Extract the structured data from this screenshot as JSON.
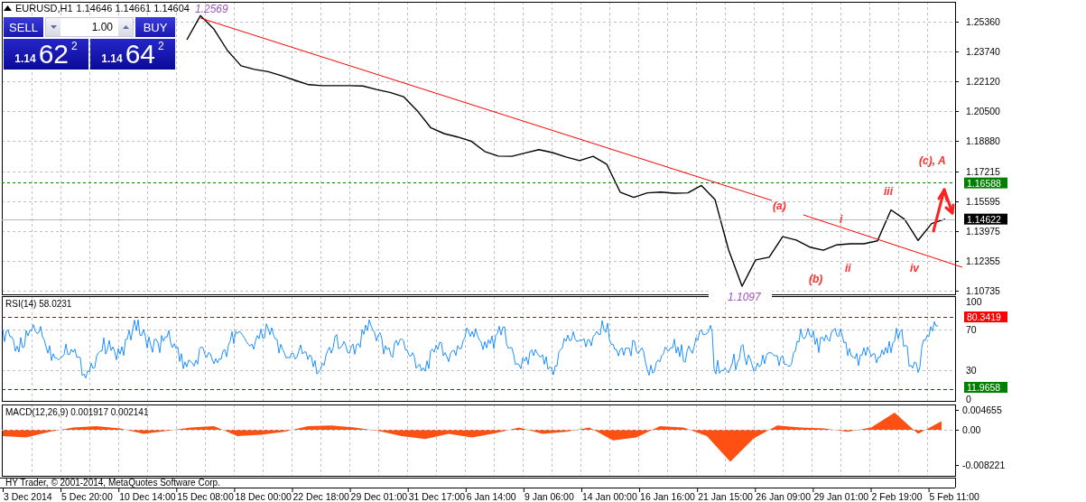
{
  "chart_header": {
    "symbol": "EURUSD,H1",
    "prices": "1.14646 1.14661 1.14604"
  },
  "trade_panel": {
    "sell_label": "SELL",
    "buy_label": "BUY",
    "volume": "1.00",
    "sell_price": {
      "prefix": "1.14",
      "big": "62",
      "sup": "2"
    },
    "buy_price": {
      "prefix": "1.14",
      "big": "64",
      "sup": "2"
    }
  },
  "main_chart": {
    "high_label": "1.2569",
    "low_label": "1.1097",
    "markers": [
      {
        "label": "1.16588",
        "color": "#008000"
      },
      {
        "label": "1.14622",
        "color": "#000000"
      }
    ],
    "wave_labels": [
      "(a)",
      "(b)",
      "(c), A",
      "i",
      "ii",
      "iii",
      "iv"
    ],
    "chart_data": {
      "type": "line",
      "ylim": [
        1.1053,
        1.2644
      ],
      "yticks": [
        {
          "value": 1.2536,
          "label": "1.25360"
        },
        {
          "value": 1.2374,
          "label": "1.23740"
        },
        {
          "value": 1.2212,
          "label": "1.22120"
        },
        {
          "value": 1.205,
          "label": "1.20500"
        },
        {
          "value": 1.1888,
          "label": "1.18880"
        },
        {
          "value": 1.17215,
          "label": "1.17215"
        },
        {
          "value": 1.15595,
          "label": "1.15595"
        },
        {
          "value": 1.13975,
          "label": "1.13975"
        },
        {
          "value": 1.12355,
          "label": "1.12355"
        },
        {
          "value": 1.10735,
          "label": "1.10735"
        }
      ],
      "series": [
        {
          "color": "#000000",
          "values": [
            null,
            1.2438,
            1.2569,
            1.2495,
            1.2379,
            1.2296,
            1.2276,
            1.2264,
            1.2242,
            1.2217,
            1.2193,
            1.2188,
            1.2188,
            1.2188,
            1.2186,
            1.2167,
            1.2151,
            1.2128,
            1.2053,
            1.196,
            1.1927,
            1.1909,
            1.1886,
            1.183,
            1.1805,
            1.1804,
            1.1822,
            1.184,
            1.1824,
            1.18,
            1.178,
            1.1804,
            1.1761,
            1.1609,
            1.158,
            1.1605,
            1.1609,
            1.1603,
            1.1605,
            1.1645,
            1.1569,
            1.1296,
            1.1097,
            1.124,
            1.1255,
            1.1367,
            1.1348,
            1.131,
            1.1293,
            1.1322,
            1.1328,
            1.1328,
            1.1344,
            1.1512,
            1.1461,
            1.1346,
            1.1438,
            1.1462
          ]
        }
      ]
    }
  },
  "rsi": {
    "title": "RSI(14) 58.0231",
    "axis": [
      "100",
      "70",
      "30",
      "0"
    ],
    "markers": [
      {
        "label": "80.3419",
        "color": "#ff0000"
      },
      {
        "label": "11.9658",
        "color": "#008000"
      }
    ]
  },
  "macd": {
    "title": "MACD(12,26,9) 0.001917 0.002141",
    "chart_data": {
      "type": "area",
      "ylim": [
        -0.0108,
        0.0059
      ],
      "yticks": [
        {
          "value": 0.004655,
          "label": "0.004655"
        },
        {
          "value": 0,
          "label": "0.00"
        },
        {
          "value": -0.008221,
          "label": "-0.008221"
        }
      ],
      "series": [
        {
          "color": "#ff5014",
          "values": [
            -0.0015,
            -0.0018,
            -0.0005,
            0.0005,
            0.0008,
            0.0003,
            -0.001,
            -0.0003,
            0.0005,
            0.0008,
            -0.0015,
            -0.0012,
            -0.0005,
            0.0008,
            0.001,
            0.0005,
            -0.0003,
            -0.0015,
            -0.0022,
            -0.001,
            -0.0018,
            -0.0008,
            0.0005,
            -0.001,
            -0.0005,
            0.0005,
            -0.0025,
            -0.0018,
            0.0008,
            0.0005,
            -0.0015,
            -0.0075,
            -0.002,
            0.001,
            0.0005,
            0.0003,
            -0.0005,
            0.0005,
            0.004,
            -0.001,
            0.002
          ]
        }
      ]
    }
  },
  "copyright": "HY Trader, © 2001-2014, MetaQuotes Software Corp.",
  "time_axis": [
    "3 Dec 2014",
    "5 Dec 20:00",
    "10 Dec 14:00",
    "15 Dec 08:00",
    "18 Dec 00:00",
    "22 Dec 18:00",
    "29 Dec 01:00",
    "31 Dec 17:00",
    "6 Jan 14:00",
    "9 Jan 06:00",
    "14 Jan 00:00",
    "16 Jan 16:00",
    "21 Jan 15:00",
    "26 Jan 09:00",
    "29 Jan 01:00",
    "2 Feb 19:00",
    "5 Feb 11:00"
  ]
}
